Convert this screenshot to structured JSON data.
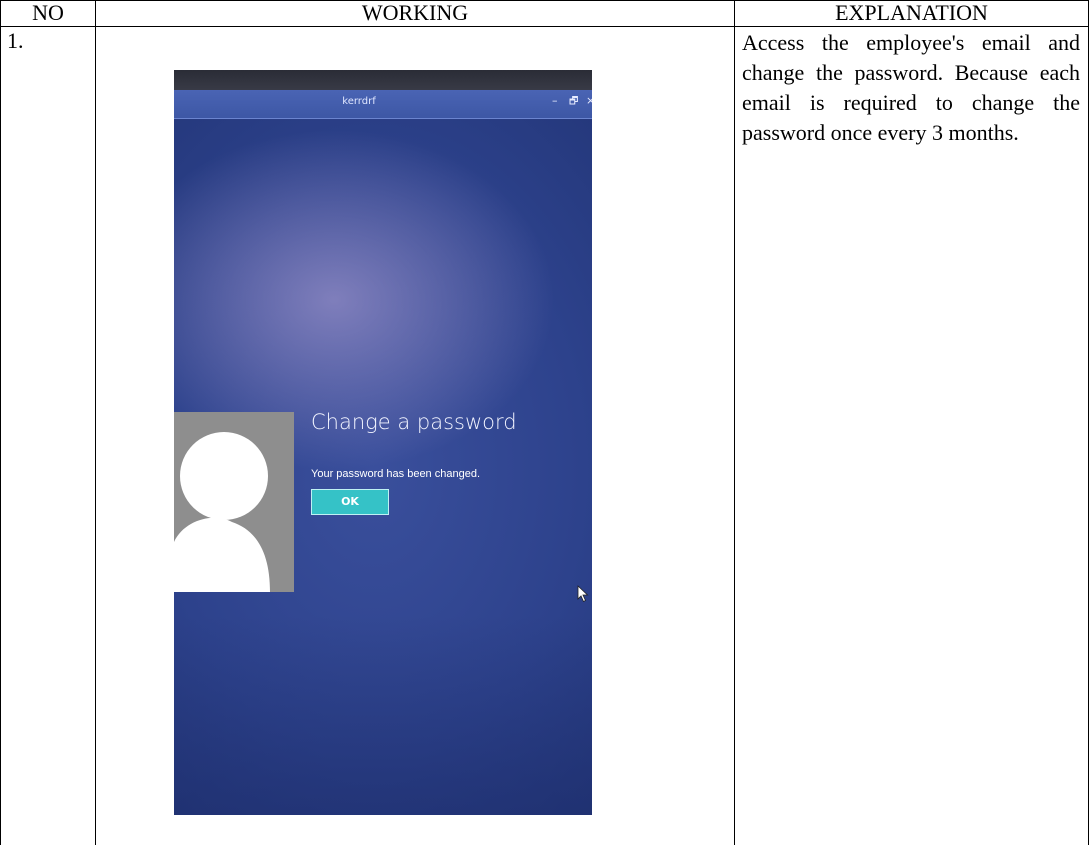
{
  "table": {
    "headers": {
      "no": "NO",
      "working": "WORKING",
      "explanation": "EXPLANATION"
    },
    "rows": [
      {
        "no": "1.",
        "explanation": "Access the employee's email and change the password. Because each email is required to change the password once every 3 months.",
        "screenshot": {
          "window_title": "kerrdrf",
          "window_controls": {
            "minimize": "–",
            "maximize": "🗗",
            "close": "×"
          },
          "icons": [
            "user-avatar-icon",
            "mouse-cursor-icon"
          ],
          "dialog": {
            "title": "Change a password",
            "message": "Your password has been changed.",
            "ok_label": "OK"
          },
          "colors": {
            "background": "#2d428c",
            "titlebar": "#4a64b4",
            "ok_button": "#35c2c7",
            "avatar_bg": "#8e8e8e"
          }
        }
      }
    ]
  }
}
